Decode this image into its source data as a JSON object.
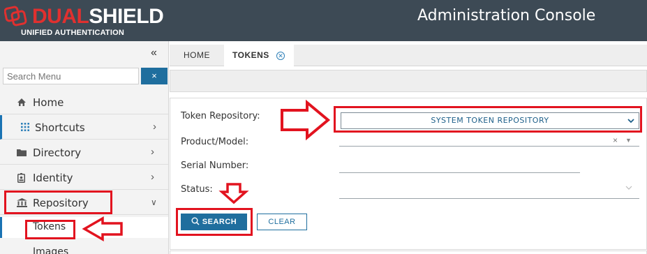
{
  "header": {
    "logo_main_red": "DUAL",
    "logo_main": "SHIELD",
    "logo_sub": "UNIFIED AUTHENTICATION",
    "title": "Administration Console"
  },
  "sidebar": {
    "collapse_icon": "double-chevron-left-icon",
    "search_placeholder": "Search Menu",
    "search_clear": "×",
    "items": [
      {
        "label": "Home",
        "icon": "home-icon"
      },
      {
        "label": "Shortcuts",
        "icon": "grid-icon"
      },
      {
        "label": "Directory",
        "icon": "folder-icon"
      },
      {
        "label": "Identity",
        "icon": "id-badge-icon"
      },
      {
        "label": "Repository",
        "icon": "bank-icon"
      },
      {
        "label": "Tokens"
      },
      {
        "label": "Images"
      }
    ]
  },
  "tabs": [
    {
      "label": "HOME"
    },
    {
      "label": "TOKENS"
    }
  ],
  "form": {
    "fields": {
      "repo_label": "Token Repository:",
      "repo_value": "SYSTEM TOKEN REPOSITORY",
      "product_label": "Product/Model:",
      "serial_label": "Serial Number:",
      "status_label": "Status:"
    },
    "search_button": "SEARCH",
    "clear_button": "CLEAR"
  },
  "colors": {
    "header_bg": "#3d4a55",
    "brand_red": "#e0302f",
    "accent_blue": "#1f6e9e",
    "annotation_red": "#e2131f"
  }
}
